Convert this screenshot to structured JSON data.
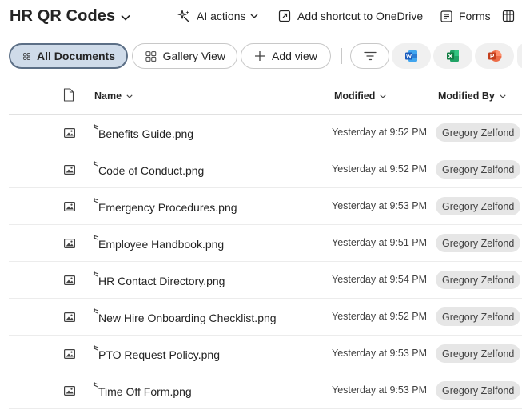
{
  "header": {
    "library_title": "HR QR Codes",
    "ai_actions_label": "AI actions",
    "add_shortcut_label": "Add shortcut to OneDrive",
    "forms_label": "Forms"
  },
  "views": {
    "all_documents_label": "All Documents",
    "gallery_view_label": "Gallery View",
    "add_view_label": "Add view"
  },
  "colors": {
    "accent": "#5c6f86",
    "selected_view_bg": "#cfdbe9",
    "word": "#185abd",
    "excel": "#107c41",
    "powerpoint": "#c43e1c"
  },
  "columns": {
    "name": "Name",
    "modified": "Modified",
    "modified_by": "Modified By"
  },
  "files": [
    {
      "name": "Benefits Guide.png",
      "modified": "Yesterday at 9:52 PM",
      "modified_by": "Gregory Zelfond"
    },
    {
      "name": "Code of Conduct.png",
      "modified": "Yesterday at 9:52 PM",
      "modified_by": "Gregory Zelfond"
    },
    {
      "name": "Emergency Procedures.png",
      "modified": "Yesterday at 9:53 PM",
      "modified_by": "Gregory Zelfond"
    },
    {
      "name": "Employee Handbook.png",
      "modified": "Yesterday at 9:51 PM",
      "modified_by": "Gregory Zelfond"
    },
    {
      "name": "HR Contact Directory.png",
      "modified": "Yesterday at 9:54 PM",
      "modified_by": "Gregory Zelfond"
    },
    {
      "name": "New Hire Onboarding Checklist.png",
      "modified": "Yesterday at 9:52 PM",
      "modified_by": "Gregory Zelfond"
    },
    {
      "name": "PTO Request Policy.png",
      "modified": "Yesterday at 9:53 PM",
      "modified_by": "Gregory Zelfond"
    },
    {
      "name": "Time Off Form.png",
      "modified": "Yesterday at 9:53 PM",
      "modified_by": "Gregory Zelfond"
    }
  ]
}
